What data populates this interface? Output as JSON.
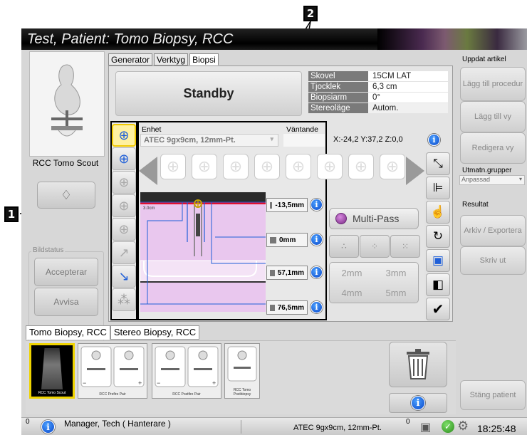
{
  "title": "Test, Patient:  Tomo Biopsy, RCC",
  "callouts": {
    "one": "1",
    "two": "2"
  },
  "left": {
    "view_label": "RCC Tomo Scout",
    "bildstatus_label": "Bildstatus",
    "accept_label": "Accepterar",
    "reject_label": "Avvisa"
  },
  "tabs": [
    "Generator",
    "Verktyg",
    "Biopsi"
  ],
  "status_text": "Standby",
  "props": [
    {
      "label": "Skovel",
      "value": "15CM LAT"
    },
    {
      "label": "Tjocklek",
      "value": "6,3 cm"
    },
    {
      "label": "Biopsiarm",
      "value": "0°"
    },
    {
      "label": "Stereoläge",
      "value": "Autom."
    }
  ],
  "device": {
    "label": "Enhet",
    "value": "ATEC 9gx9cm, 12mm-Pt.",
    "waiting_label": "Väntande",
    "coords": "X:-24,2 Y:37,2 Z:0,0"
  },
  "diagram": {
    "scale_label": "3.0cm",
    "distances": [
      "-13,5mm",
      "0mm",
      "57,1mm",
      "76,5mm"
    ]
  },
  "multipass": {
    "label": "Multi-Pass",
    "offsets": [
      "2mm",
      "3mm",
      "4mm",
      "5mm"
    ]
  },
  "right": {
    "update_header": "Uppdat artikel",
    "add_procedure": "Lägg till procedur",
    "add_view": "Lägg till vy",
    "edit_view": "Redigera vy",
    "output_groups_label": "Utmatn.grupper",
    "output_group_value": "Anpassad",
    "results_label": "Resultat",
    "archive_export": "Arkiv / Exportera",
    "print": "Skriv ut",
    "close_patient": "Stäng patient"
  },
  "bottom_tabs": [
    "Tomo Biopsy, RCC",
    "Stereo Biopsy, RCC"
  ],
  "thumbnails": [
    "RCC Tomo Scout",
    "RCC Prefire Pair",
    "RCC Postfire Pair",
    "RCC Tomo Postbiopsy"
  ],
  "statusbar": {
    "count_left": "0",
    "user": "Manager, Tech ( Hanterare )",
    "device": "ATEC 9gx9cm, 12mm-Pt.",
    "count_right": "0",
    "time": "18:25:48"
  },
  "colors": {
    "accent_blue": "#1f5fd8",
    "highlight_yellow": "#f0d400",
    "diagram_pink": "#e9c7ee",
    "laser_red": "#e01030"
  },
  "icons": [
    "target-icon",
    "trash-icon",
    "info-icon",
    "check-icon",
    "arrow-left-icon",
    "arrow-right-icon"
  ]
}
